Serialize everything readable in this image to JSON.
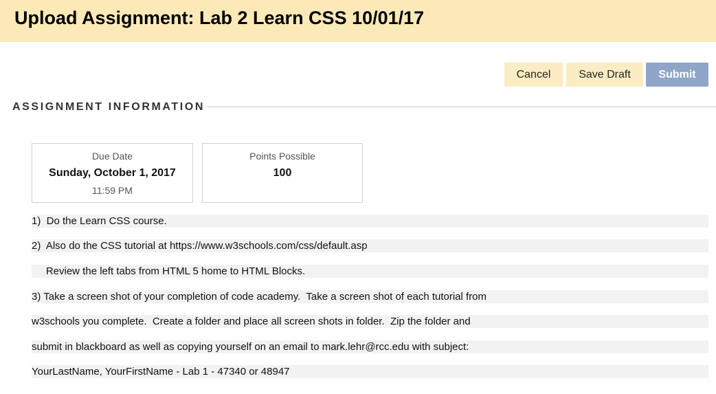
{
  "header": {
    "title": "Upload Assignment: Lab 2 Learn CSS 10/01/17"
  },
  "actions": {
    "cancel_label": "Cancel",
    "save_draft_label": "Save Draft",
    "submit_label": "Submit"
  },
  "section": {
    "title": "ASSIGNMENT INFORMATION"
  },
  "due": {
    "label": "Due Date",
    "date": "Sunday, October 1, 2017",
    "time": "11:59 PM"
  },
  "points": {
    "label": "Points Possible",
    "value": "100"
  },
  "instructions": [
    "1)  Do the Learn CSS course.",
    "2)  Also do the CSS tutorial at https://www.w3schools.com/css/default.asp",
    "     Review the left tabs from HTML 5 home to HTML Blocks.",
    "3) Take a screen shot of your completion of code academy.  Take a screen shot of each tutorial from",
    "w3schools you complete.  Create a folder and place all screen shots in folder.  Zip the folder and",
    "submit in blackboard as well as copying yourself on an email to mark.lehr@rcc.edu with subject:",
    "YourLastName, YourFirstName - Lab 1 - 47340 or 48947"
  ],
  "colors": {
    "header_bg": "#fbe9b7",
    "secondary_button": "#fbecc4",
    "submit_button": "#8fa6c8"
  }
}
